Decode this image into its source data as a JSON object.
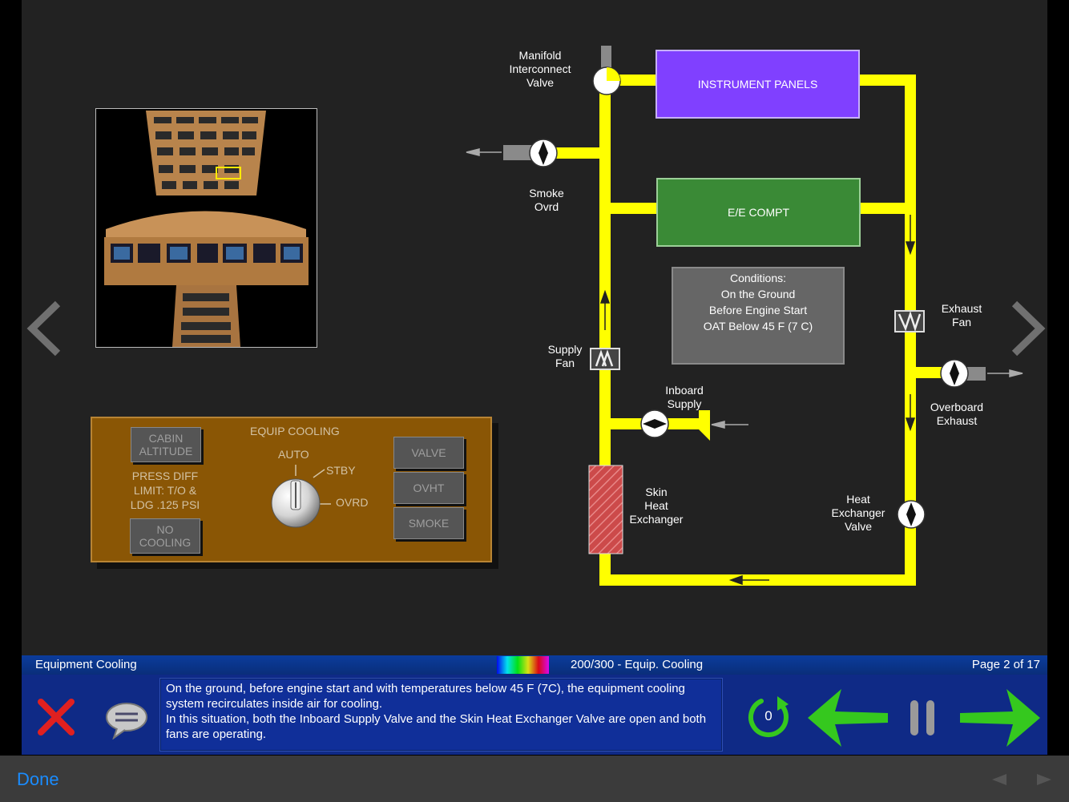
{
  "diagram": {
    "labels": {
      "manifold_valve": [
        "Manifold",
        "Interconnect",
        "Valve"
      ],
      "smoke_ovrd": [
        "Smoke",
        "Ovrd"
      ],
      "supply_fan": [
        "Supply",
        "Fan"
      ],
      "inboard_supply": [
        "Inboard",
        "Supply"
      ],
      "skin_hx": [
        "Skin",
        "Heat",
        "Exchanger"
      ],
      "exhaust_fan": [
        "Exhaust",
        "Fan"
      ],
      "overboard_exhaust": [
        "Overboard",
        "Exhaust"
      ],
      "hx_valve": [
        "Heat",
        "Exchanger",
        "Valve"
      ]
    },
    "boxes": {
      "instrument_panels": "INSTRUMENT PANELS",
      "ee_compt": "E/E COMPT",
      "conditions": [
        "Conditions:",
        "On the Ground",
        "Before Engine Start",
        "OAT Below 45 F (7 C)"
      ]
    },
    "colors": {
      "duct": "#ffff00",
      "instrument_panels": "#8040ff",
      "ee_compt": "#3a8a36",
      "conditions": "#666666",
      "skin_hx": "#cc4444"
    }
  },
  "control_panel": {
    "title": "EQUIP COOLING",
    "cabin_altitude": [
      "CABIN",
      "ALTITUDE"
    ],
    "press_diff": [
      "PRESS DIFF",
      "LIMIT: T/O &",
      "LDG .125 PSI"
    ],
    "no_cooling": [
      "NO",
      "COOLING"
    ],
    "knob_positions": {
      "auto": "AUTO",
      "stby": "STBY",
      "ovrd": "OVRD"
    },
    "lights": {
      "valve": "VALVE",
      "ovht": "OVHT",
      "smoke": "SMOKE"
    }
  },
  "status_bar": {
    "left": "Equipment Cooling",
    "center": "200/300 - Equip. Cooling",
    "right": "Page 2 of 17"
  },
  "narration": {
    "line1": "On the ground, before engine start and with temperatures below 45 F (7C), the equipment cooling",
    "line2": "system recirculates inside air for cooling.",
    "line3": "In this situation, both the Inboard Supply Valve and the Skin Heat Exchanger Valve are open and both",
    "line4": "fans are operating."
  },
  "controls": {
    "replay_count": "0",
    "icons": [
      "close-icon",
      "caption-icon",
      "replay-icon",
      "back-arrow-icon",
      "pause-icon",
      "forward-arrow-icon"
    ]
  },
  "bottom_bar": {
    "done": "Done"
  }
}
